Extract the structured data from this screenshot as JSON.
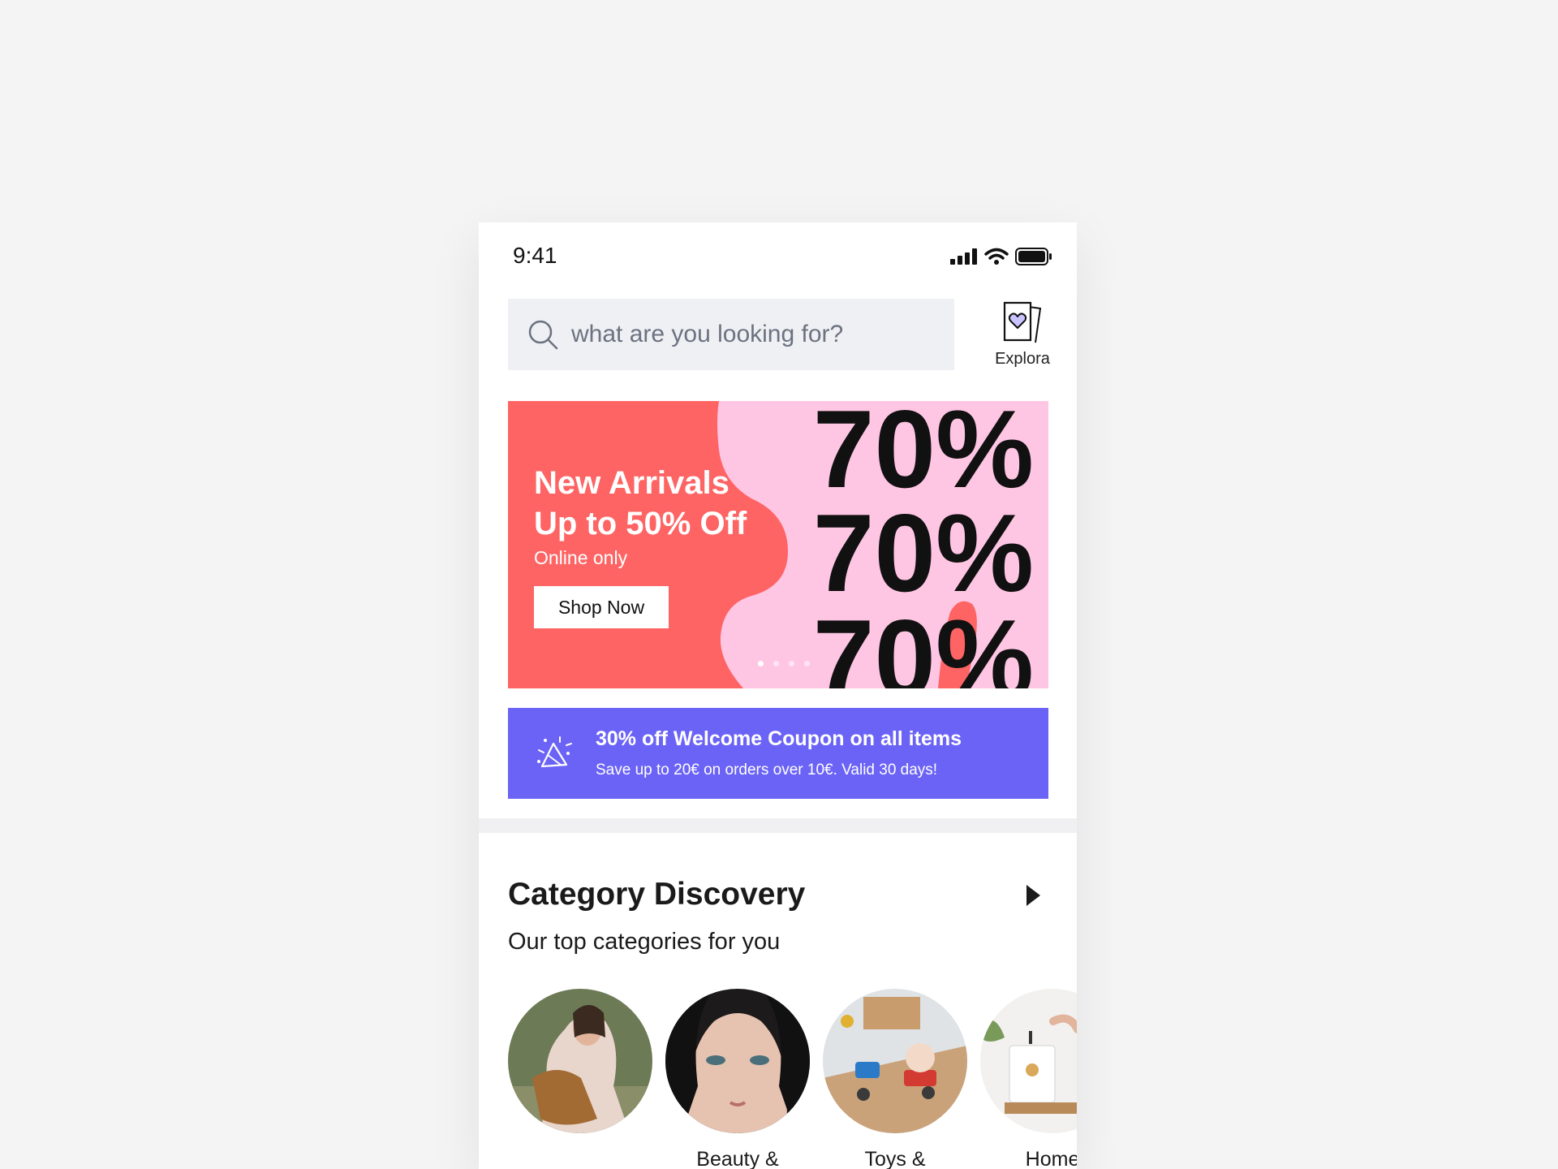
{
  "status_bar": {
    "time": "9:41",
    "icons": [
      "signal-icon",
      "wifi-icon",
      "battery-icon"
    ]
  },
  "search": {
    "placeholder": "what are you looking for?"
  },
  "explora": {
    "label": "Explora",
    "icon": "explora-heart-icon"
  },
  "hero": {
    "title_line1": "New Arrivals",
    "title_line2": "Up to 50% Off",
    "subtitle": "Online only",
    "button": "Shop Now",
    "graphic_text": [
      "70%",
      "70%",
      "70%"
    ],
    "slide_count": 4,
    "active_slide": 1,
    "colors": {
      "primary": "#fe6464",
      "secondary": "#ffc6e4"
    }
  },
  "coupon": {
    "icon": "party-popper-icon",
    "title": "30% off Welcome Coupon on all items",
    "subtitle": "Save up to 20€ on orders over 10€. Valid 30 days!",
    "color": "#6b63f6"
  },
  "categories": {
    "title": "Category Discovery",
    "subtitle": "Our top categories for you",
    "arrow_icon": "chevron-right-icon",
    "items": [
      {
        "label": ""
      },
      {
        "label": "Beauty &"
      },
      {
        "label": "Toys &"
      },
      {
        "label": "Home"
      }
    ]
  }
}
